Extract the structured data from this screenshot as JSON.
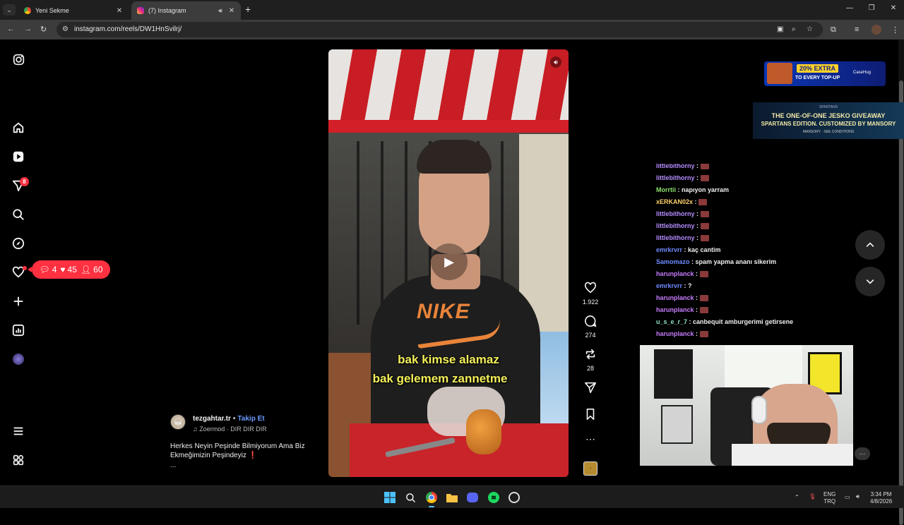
{
  "browser": {
    "tabs": [
      {
        "title": "Yeni Sekme",
        "active": false
      },
      {
        "title": "(7) Instagram",
        "active": true
      }
    ],
    "url": "instagram.com/reels/DW1HnSvilrj/",
    "icons": {
      "new_tab": "+",
      "back": "←",
      "forward": "→",
      "reload": "↻",
      "close": "✕",
      "minimize": "—",
      "restore": "❐"
    }
  },
  "sidebar": {
    "notification_badge": "8"
  },
  "notif_pill": {
    "comments": "4",
    "likes": "45",
    "followers": "60"
  },
  "reel": {
    "captions": [
      "bak kimse alamaz",
      "bak gelemem zannetme"
    ],
    "shirt_text": "NIKE",
    "likes": "1.922",
    "comments": "274",
    "reposts": "28",
    "author": "tezgahtar.tr",
    "follow_label": "Takip Et",
    "music": "Zoermod · DIR DIR DIR",
    "description": "Herkes Neyin Peşinde Bilmiyorum Ama Biz Ekmeğimizin Peşindeyiz ❗",
    "more": "..."
  },
  "ads": {
    "topup_pct": "20% EXTRA",
    "topup_sub": "TO EVERY TOP-UP",
    "topup_brand": "CaseHug",
    "giveaway_small": "SPARTANS",
    "giveaway_line1": "THE ONE-OF-ONE JESKO GIVEAWAY",
    "giveaway_line2": "SPARTANS EDITION. CUSTOMIZED BY MANSORY",
    "giveaway_line3": "MANSORY · SEE CONDITIONS"
  },
  "chat": [
    {
      "user": "littlebithorny",
      "color": "#b58cff",
      "msg": "",
      "emote": true
    },
    {
      "user": "littlebithorny",
      "color": "#b58cff",
      "msg": "",
      "emote": true
    },
    {
      "user": "Morrtii",
      "color": "#8ee06a",
      "msg": "napıyon yarram",
      "emote": false
    },
    {
      "user": "xERKAN02x",
      "color": "#ffd36b",
      "msg": "",
      "emote": true
    },
    {
      "user": "littlebithorny",
      "color": "#b58cff",
      "msg": "",
      "emote": true
    },
    {
      "user": "littlebithorny",
      "color": "#b58cff",
      "msg": "",
      "emote": true
    },
    {
      "user": "littlebithorny",
      "color": "#b58cff",
      "msg": "",
      "emote": true
    },
    {
      "user": "emrkrvrr",
      "color": "#6f8cff",
      "msg": "kaç cantim",
      "emote": false
    },
    {
      "user": "Samomazo",
      "color": "#6f8cff",
      "msg": "spam yapma ananı sikerim",
      "emote": false
    },
    {
      "user": "harunplanck",
      "color": "#c77dff",
      "msg": "",
      "emote": true
    },
    {
      "user": "emrkrvrr",
      "color": "#6f8cff",
      "msg": "?",
      "emote": false
    },
    {
      "user": "harunplanck",
      "color": "#c77dff",
      "msg": "",
      "emote": true
    },
    {
      "user": "harunplanck",
      "color": "#c77dff",
      "msg": "",
      "emote": true
    },
    {
      "user": "u_s_e_r_7",
      "color": "#8ee0c6",
      "msg": "canbequit amburgerimi getirsene",
      "emote": false
    },
    {
      "user": "harunplanck",
      "color": "#c77dff",
      "msg": "",
      "emote": true
    }
  ],
  "taskbar": {
    "lang_top": "ENG",
    "lang_bottom": "TRQ",
    "time": "3:34 PM",
    "date": "4/8/2026"
  },
  "colors": {
    "accent_red": "#ff3040",
    "follow_blue": "#6c9bff",
    "caption_yellow": "#f5f05a"
  }
}
